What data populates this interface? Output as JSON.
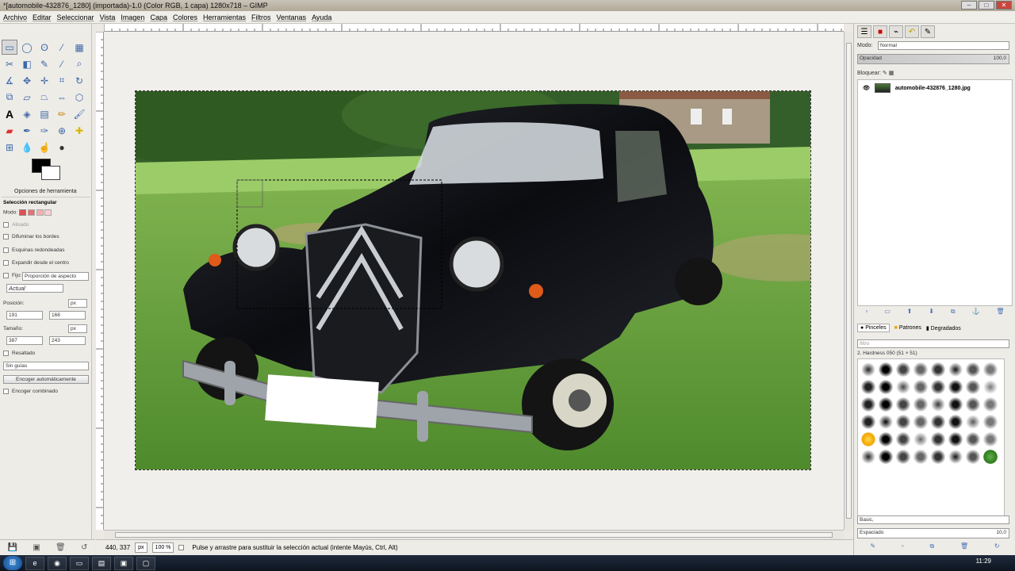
{
  "window": {
    "title": "*[automobile-432876_1280] (importada)-1.0 (Color RGB, 1 capa) 1280x718 – GIMP"
  },
  "menu": [
    "Archivo",
    "Editar",
    "Seleccionar",
    "Vista",
    "Imagen",
    "Capa",
    "Colores",
    "Herramientas",
    "Filtros",
    "Ventanas",
    "Ayuda"
  ],
  "tool_options": {
    "tab_label": "Opciones de herramienta",
    "title": "Selección rectangular",
    "mode_label": "Modo:",
    "antialias": "Alisado",
    "feather": "Difuminar los bordes",
    "rounded": "Esquinas redondeadas",
    "expand_center": "Expandir desde el centro",
    "fixed_label": "Fijo:",
    "fixed_value": "Proporción de aspecto",
    "current": "Actual",
    "position_label": "Posición:",
    "position_unit": "px",
    "pos_x": "191",
    "pos_y": "168",
    "size_label": "Tamaño:",
    "size_unit": "px",
    "size_w": "387",
    "size_h": "243",
    "highlight": "Resaltado",
    "guides": "Sin guías",
    "autoshrink": "Encoger automáticamente",
    "shrink_merged": "Encoger combinado"
  },
  "status": {
    "coords": "440, 337",
    "unit": "px",
    "zoom": "100 %",
    "message": "Pulse y arrastre para sustituir la selección actual (intente Mayús, Ctrl, Alt)"
  },
  "layers": {
    "mode_label": "Modo:",
    "mode_value": "Normal",
    "opacity_label": "Opacidad",
    "opacity_value": "100,0",
    "lock_label": "Bloquear:",
    "layer_name": "automobile-432876_1280.jpg"
  },
  "brushes": {
    "tab_brushes": "Pinceles",
    "tab_patterns": "Patrones",
    "tab_gradients": "Degradados",
    "filter_placeholder": "filtro",
    "selected_brush": "2. Hardness 050 (51 × 51)",
    "preset": "Basic,",
    "spacing_label": "Espaciado",
    "spacing_value": "10,0"
  },
  "taskbar": {
    "clock": "11:29"
  }
}
